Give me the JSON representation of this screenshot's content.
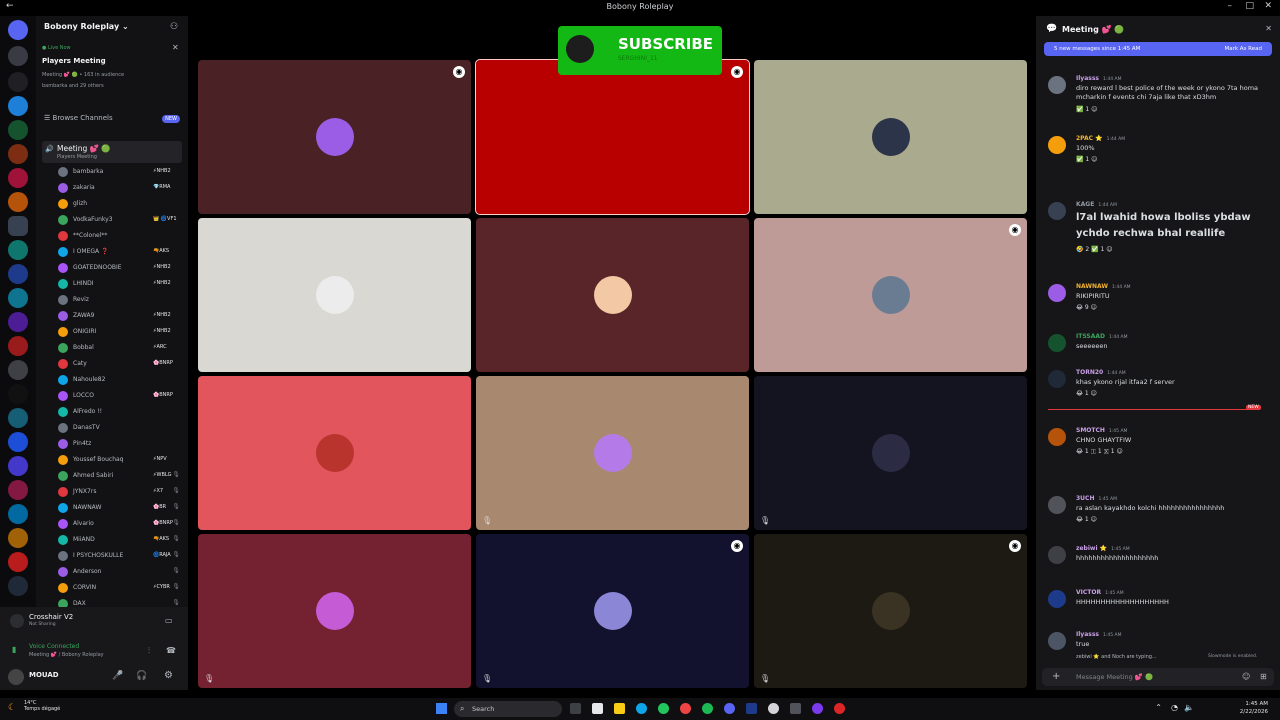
{
  "window": {
    "title": "Bobony Roleplay"
  },
  "sidebar": {
    "server_name": "Bobony Roleplay",
    "live_label": "Live Now",
    "event_title": "Players Meeting",
    "event_meta": "Meeting 💕 🟢 • 163 in audience",
    "event_others": "bambarka and 29 others",
    "browse_channels": "Browse Channels",
    "browse_badge": "NEW",
    "voice_channel": "Meeting 💕 🟢",
    "voice_channel_sub": "Players Meeting",
    "members": [
      {
        "name": "bambarka",
        "tag": "⚡NHB2"
      },
      {
        "name": "zakaria",
        "tag": "💎RMA"
      },
      {
        "name": "glizh",
        "tag": ""
      },
      {
        "name": "VodkaFunky3",
        "tag": "👑 🌀VF1"
      },
      {
        "name": "**Colonel**",
        "tag": ""
      },
      {
        "name": "I OMEGA ❓",
        "tag": "🔫AKS"
      },
      {
        "name": "GOATEDNOOBIE",
        "tag": "⚡NHB2"
      },
      {
        "name": "LHINDI",
        "tag": "⚡NHB2"
      },
      {
        "name": "Reviz",
        "tag": ""
      },
      {
        "name": "ZAWA9",
        "tag": "⚡NHB2"
      },
      {
        "name": "ONIGIRI",
        "tag": "⚡NHB2"
      },
      {
        "name": "Bobbal",
        "tag": "⚡ARC"
      },
      {
        "name": "Caty",
        "tag": "🌸BNRP"
      },
      {
        "name": "Nahoule82",
        "tag": ""
      },
      {
        "name": "LOCCO",
        "tag": "🌸BNRP"
      },
      {
        "name": "AlFredo !!",
        "tag": ""
      },
      {
        "name": "DanasTV",
        "tag": ""
      },
      {
        "name": "Pin4tz",
        "tag": ""
      },
      {
        "name": "Youssef Bouchaq",
        "tag": "⚡NPV"
      },
      {
        "name": "Ahmed Sabiri",
        "tag": "⚡WBLG"
      },
      {
        "name": "JYNX7rs",
        "tag": "⚡X7"
      },
      {
        "name": "NAWNAW",
        "tag": "🌸BR"
      },
      {
        "name": "Alvario",
        "tag": "🌸BNRP"
      },
      {
        "name": "MiiAND",
        "tag": "🔫AKS"
      },
      {
        "name": "I PSYCHOSKULLE",
        "tag": "🌀RAJA"
      },
      {
        "name": "Anderson",
        "tag": ""
      },
      {
        "name": "CORVIN",
        "tag": "⚡CYBR"
      },
      {
        "name": "DAX",
        "tag": ""
      }
    ],
    "new_unreads": "NEW UNREADS"
  },
  "panel": {
    "activity_name": "Crosshair V2",
    "activity_sub": "Not Sharing",
    "voice_status": "Voice Connected",
    "voice_location": "Meeting 💕 / Bobony Roleplay",
    "username": "MOUAD"
  },
  "overlay": {
    "subscribe": "SUBSCRIBE",
    "handle": "SERGHINI_11"
  },
  "tiles": [
    {
      "color": "#4a2226",
      "face": "#9b5de5"
    },
    {
      "color": "#b90000",
      "face": ""
    },
    {
      "color": "#a9aa8e",
      "face": "#2b3448"
    },
    {
      "color": "#d9d8d3",
      "face": "#ececec"
    },
    {
      "color": "#5a2528",
      "face": "#f2c9a4"
    },
    {
      "color": "#bf9b98",
      "face": "#6a7c92"
    },
    {
      "color": "#e2555c",
      "face": "#b8342c"
    },
    {
      "color": "#a8896f",
      "face": "#b47be8"
    },
    {
      "color": "#141420",
      "face": "#2b2c44"
    },
    {
      "color": "#742232",
      "face": "#c55cd6"
    },
    {
      "color": "#12122e",
      "face": "#8c86d6"
    },
    {
      "color": "#1d1a14",
      "face": "#3a3222"
    }
  ],
  "chat": {
    "header": "Meeting 💕 🟢",
    "new_messages": "5 new messages since 1:45 AM",
    "mark_as_read": "Mark As Read",
    "messages": [
      {
        "author": "Ilyasss",
        "time": "1:44 AM",
        "color": "#c9a0e8",
        "text": "diro reward l best police of the week or ykono 7ta homa mcharkin f events chi 7aja like that xD3hm",
        "reacts": "✅ 1   ☺"
      },
      {
        "author": "2PAC ⭐",
        "time": "1:44 AM",
        "color": "#f0b232",
        "text": "100%",
        "reacts": "✅ 1   ☺"
      },
      {
        "author": "KAGE",
        "time": "1:44 AM",
        "color": "#949ba4",
        "text": "l7al lwahid howa lboliss ybdaw ychdo rechwa bhal reallife",
        "reacts": "🤣 2   ✅ 1   ☺",
        "big": true
      },
      {
        "author": "NAWNAW",
        "time": "1:44 AM",
        "color": "#f0b232",
        "text": "RIKIPIRITU",
        "reacts": "😂 9   ☺"
      },
      {
        "author": "ITSSAAD",
        "time": "1:44 AM",
        "color": "#3ba55d",
        "text": "seeeeeen",
        "reacts": ""
      },
      {
        "author": "TORN20",
        "time": "1:44 AM",
        "color": "#c9a0e8",
        "text": "khas ykono rijal itfaa2 f server",
        "reacts": "😂 1   ☺"
      },
      {
        "author": "SMOTCH",
        "time": "1:45 AM",
        "color": "#c9a0e8",
        "text": "CHNO GHAYTFIW",
        "reacts": "😂 1   🇮 1   🇽 1   ☺"
      },
      {
        "author": "3UCH",
        "time": "1:45 AM",
        "color": "#c9a0e8",
        "text": "ra aslan kayakhdo kolchi hhhhhhhhhhhhhhhh",
        "reacts": "😂 1   ☺"
      },
      {
        "author": "zebiwi ⭐",
        "time": "1:45 AM",
        "color": "#c9a0e8",
        "text": "hhhhhhhhhhhhhhhhhhhh",
        "reacts": ""
      },
      {
        "author": "VICTOR",
        "time": "1:45 AM",
        "color": "#c9a0e8",
        "text": "HHHHHHHHHHHHHHHHHHH",
        "reacts": ""
      },
      {
        "author": "Ilyasss",
        "time": "1:45 AM",
        "color": "#c9a0e8",
        "text": "true",
        "reacts": ""
      }
    ],
    "typing": "zebiwi ⭐ and Noch are typing...",
    "slowmode": "Slowmode is enabled.",
    "input_placeholder": "Message Meeting 💕 🟢"
  },
  "taskbar": {
    "weather_temp": "14°C",
    "weather_desc": "Temps dégagé",
    "search": "Search",
    "time": "1:45 AM",
    "date": "2/22/2026"
  }
}
